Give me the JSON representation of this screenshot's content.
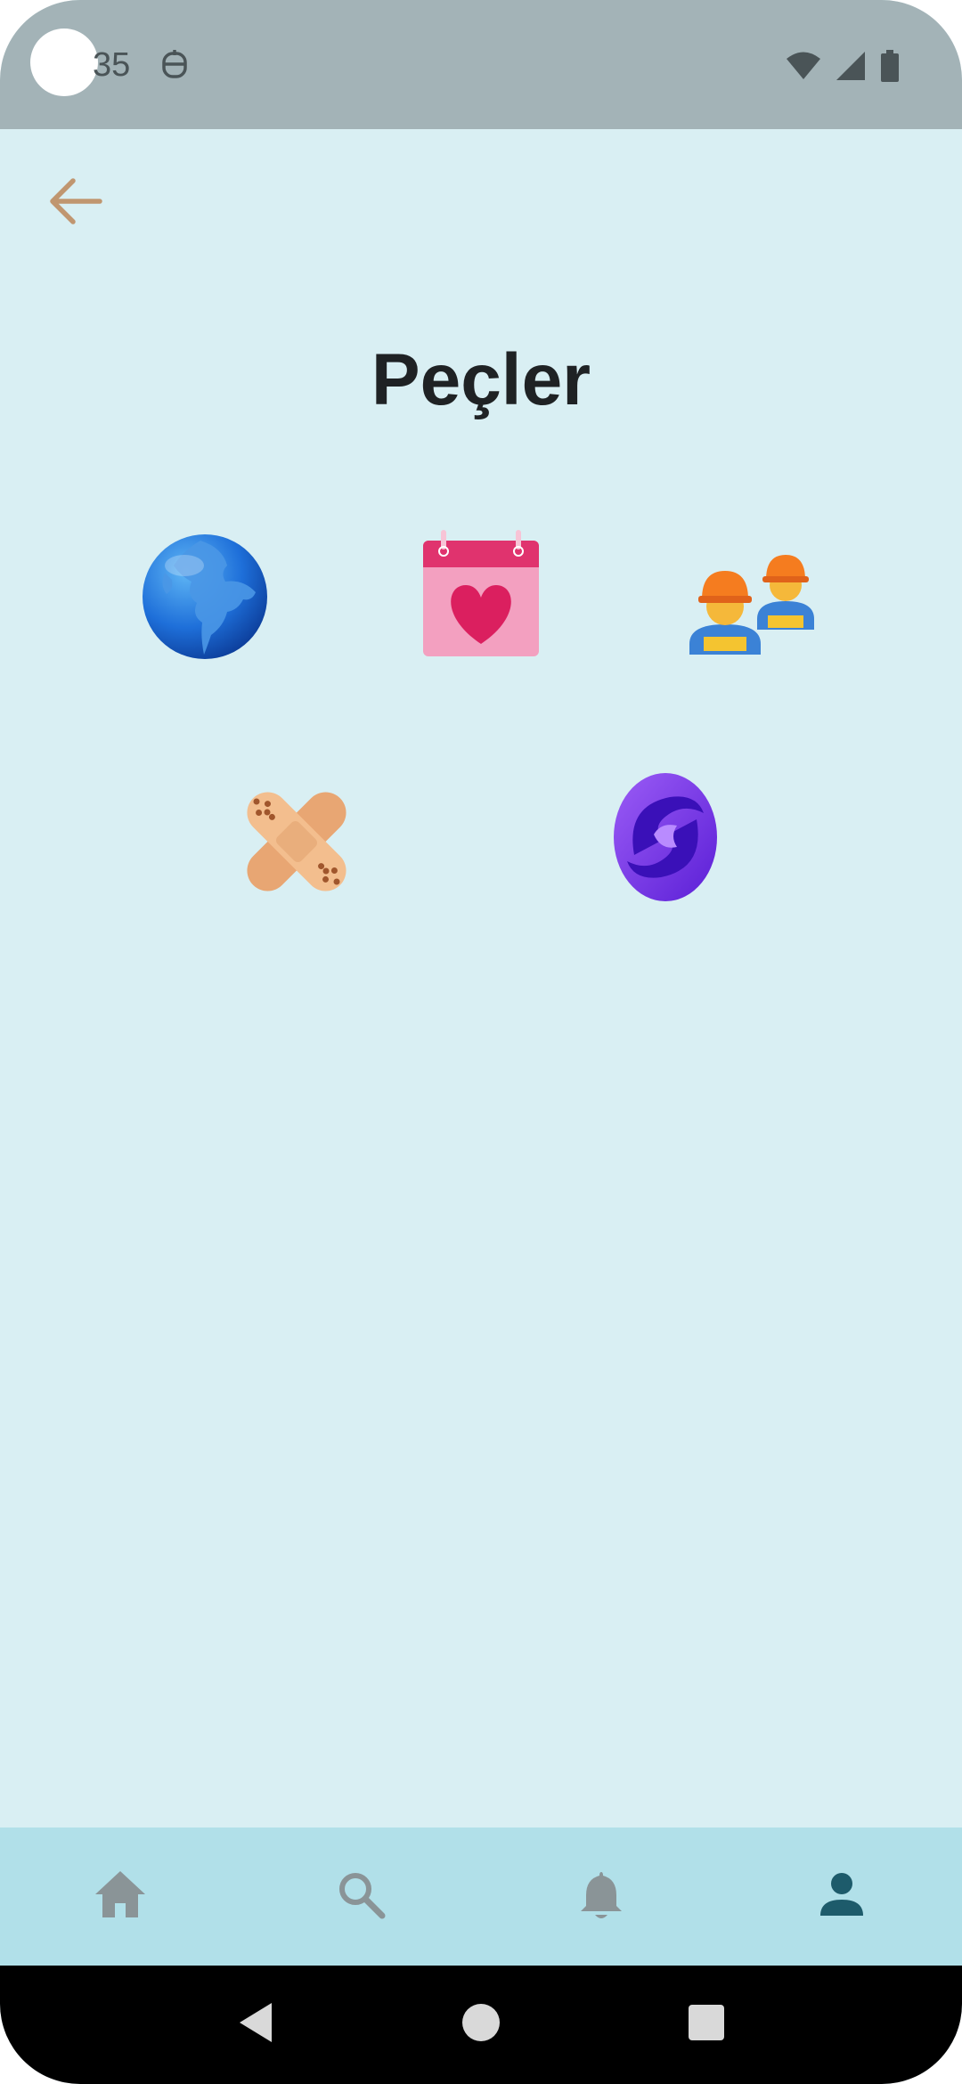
{
  "status_bar": {
    "time": "35",
    "icons": [
      "app-notification-icon",
      "wifi-icon",
      "signal-icon",
      "battery-icon"
    ]
  },
  "header": {
    "back_icon": "arrow-left-icon",
    "title": "Peçler"
  },
  "badges": [
    {
      "icon": "globe-icon"
    },
    {
      "icon": "calendar-heart-icon"
    },
    {
      "icon": "construction-workers-icon"
    },
    {
      "icon": "adhesive-bandage-icon"
    },
    {
      "icon": "swirl-logo-icon"
    }
  ],
  "bottom_nav": {
    "items": [
      {
        "icon": "home-icon",
        "active": false
      },
      {
        "icon": "search-icon",
        "active": false
      },
      {
        "icon": "bell-icon",
        "active": false
      },
      {
        "icon": "profile-icon",
        "active": true
      }
    ],
    "inactive_color": "#8a9497",
    "active_color": "#1d5b6b"
  },
  "colors": {
    "background": "#d9eff3",
    "status_bar": "#a3b3b7",
    "nav_bar": "#b1e0e9",
    "back_arrow": "#c09670"
  }
}
